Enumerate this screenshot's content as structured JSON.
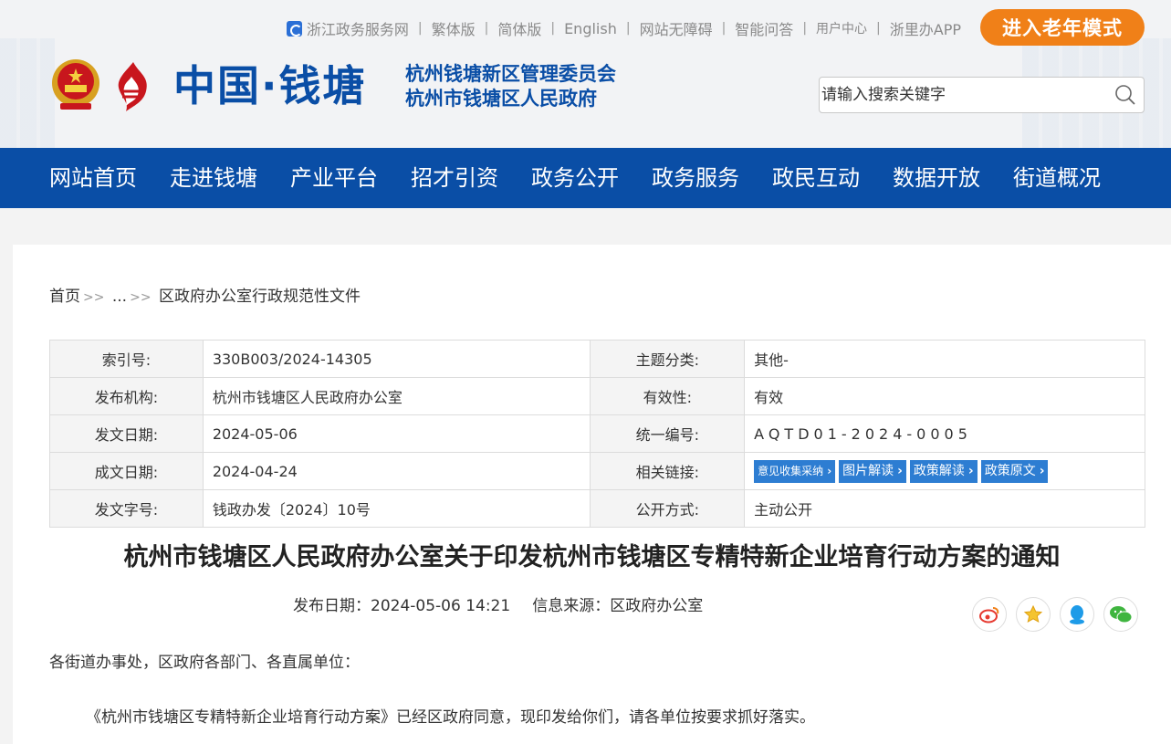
{
  "header": {
    "topbar": [
      {
        "label": "浙江政务服务网",
        "small": false
      },
      {
        "label": "繁体版",
        "small": false
      },
      {
        "label": "简体版",
        "small": false
      },
      {
        "label": "English",
        "small": false
      },
      {
        "label": "网站无障碍",
        "small": false
      },
      {
        "label": "智能问答",
        "small": false
      },
      {
        "label": "用户中心",
        "small": true
      },
      {
        "label": "浙里办APP",
        "small": false
      }
    ],
    "elder_mode": "进入老年模式",
    "site_title": "中国·钱塘",
    "site_sub_1": "杭州钱塘新区管理委员会",
    "site_sub_2": "杭州市钱塘区人民政府",
    "search_placeholder": "请输入搜索关键字"
  },
  "nav": [
    "网站首页",
    "走进钱塘",
    "产业平台",
    "招才引资",
    "政务公开",
    "政务服务",
    "政民互动",
    "数据开放",
    "街道概况"
  ],
  "breadcrumb": {
    "home": "首页",
    "sep": ">>",
    "ellipsis": "...",
    "current": "区政府办公室行政规范性文件"
  },
  "meta": {
    "index_key": "索引号:",
    "index_val": "330B003/2024-14305",
    "topic_key": "主题分类:",
    "topic_val": "其他-",
    "org_key": "发布机构:",
    "org_val": "杭州市钱塘区人民政府办公室",
    "valid_key": "有效性:",
    "valid_val": "有效",
    "date_key": "发文日期:",
    "date_val": "2024-05-06",
    "code_key": "统一编号:",
    "code_val": "AQTD01-2024-0005",
    "made_key": "成文日期:",
    "made_val": "2024-04-24",
    "rel_key": "相关链接:",
    "rel_links": [
      "意见收集采纳",
      "图片解读",
      "政策解读",
      "政策原文"
    ],
    "docno_key": "发文字号:",
    "docno_val": "钱政办发〔2024〕10号",
    "open_key": "公开方式:",
    "open_val": "主动公开"
  },
  "doc": {
    "title": "杭州市钱塘区人民政府办公室关于印发杭州市钱塘区专精特新企业培育行动方案的通知",
    "pub_date_label": "发布日期：2024-05-06 14:21",
    "source_label": "信息来源：区政府办公室",
    "para1": "各街道办事处，区政府各部门、各直属单位：",
    "para2": "《杭州市钱塘区专精特新企业培育行动方案》已经区政府同意，现印发给你们，请各单位按要求抓好落实。"
  },
  "share_icons": [
    "weibo-icon",
    "favorite-star-icon",
    "qq-icon",
    "wechat-icon"
  ],
  "colors": {
    "brand_blue": "#0a4ea6",
    "elder_orange": "#f08018",
    "link_blue": "#2d7dd2"
  }
}
